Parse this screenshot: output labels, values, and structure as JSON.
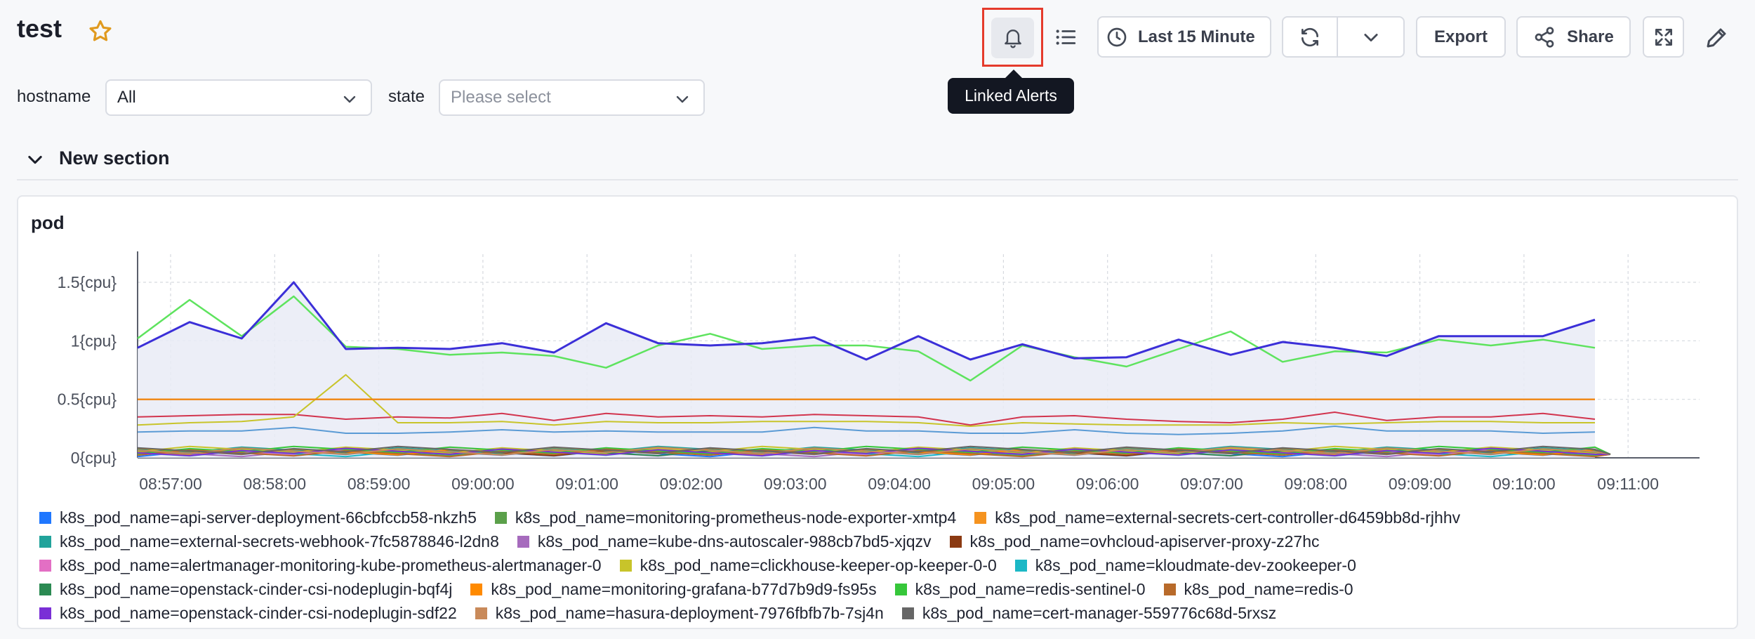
{
  "dashboard": {
    "title": "test"
  },
  "toolbar": {
    "tooltip": "Linked Alerts",
    "time_range": "Last 15 Minute",
    "export_label": "Export",
    "share_label": "Share"
  },
  "filters": [
    {
      "label": "hostname",
      "value": "All",
      "placeholder": ""
    },
    {
      "label": "state",
      "value": "",
      "placeholder": "Please select"
    }
  ],
  "section": {
    "title": "New section"
  },
  "panel": {
    "title": "pod"
  },
  "chart_data": {
    "type": "line",
    "area_fill": true,
    "x": [
      "08:57:00",
      "08:58:00",
      "08:59:00",
      "09:00:00",
      "09:01:00",
      "09:02:00",
      "09:03:00",
      "09:04:00",
      "09:05:00",
      "09:06:00",
      "09:07:00",
      "09:08:00",
      "09:09:00",
      "09:10:00",
      "09:11:00"
    ],
    "y_ticks": [
      "0{cpu}",
      "0.5{cpu}",
      "1{cpu}",
      "1.5{cpu}"
    ],
    "ylim": [
      0,
      1.7
    ],
    "grid": true,
    "legend_position": "bottom",
    "series": [
      {
        "name": "k8s_pod_name=api-server-deployment-66cbfccb58-nkzh5",
        "color": "#1f77ff",
        "legend_row": 0
      },
      {
        "name": "k8s_pod_name=monitoring-prometheus-node-exporter-xmtp4",
        "color": "#5ba04a",
        "legend_row": 0
      },
      {
        "name": "k8s_pod_name=external-secrets-cert-controller-d6459bb8d-rjhhv",
        "color": "#f5931f",
        "legend_row": 0
      },
      {
        "name": "k8s_pod_name=external-secrets-webhook-7fc5878846-l2dn8",
        "color": "#21a39b",
        "legend_row": 1
      },
      {
        "name": "k8s_pod_name=kube-dns-autoscaler-988cb7bd5-xjqzv",
        "color": "#a66bbd",
        "legend_row": 1
      },
      {
        "name": "k8s_pod_name=ovhcloud-apiserver-proxy-z27hc",
        "color": "#8b3a12",
        "legend_row": 1
      },
      {
        "name": "k8s_pod_name=alertmanager-monitoring-kube-prometheus-alertmanager-0",
        "color": "#e36fc4",
        "legend_row": 2
      },
      {
        "name": "k8s_pod_name=clickhouse-keeper-op-keeper-0-0",
        "color": "#c8c42a",
        "legend_row": 2
      },
      {
        "name": "k8s_pod_name=kloudmate-dev-zookeeper-0",
        "color": "#1cb8c6",
        "legend_row": 2
      },
      {
        "name": "k8s_pod_name=openstack-cinder-csi-nodeplugin-bqf4j",
        "color": "#2b8a52",
        "legend_row": 3
      },
      {
        "name": "k8s_pod_name=monitoring-grafana-b77d7b9d9-fs95s",
        "color": "#ff8a00",
        "legend_row": 3
      },
      {
        "name": "k8s_pod_name=redis-sentinel-0",
        "color": "#36c73a",
        "legend_row": 3
      },
      {
        "name": "k8s_pod_name=redis-0",
        "color": "#b86a2a",
        "legend_row": 3
      },
      {
        "name": "k8s_pod_name=openstack-cinder-csi-nodeplugin-sdf22",
        "color": "#7a2fd6",
        "legend_row": 4
      },
      {
        "name": "k8s_pod_name=hasura-deployment-7976fbfb7b-7sj4n",
        "color": "#c98a5a",
        "legend_row": 4
      },
      {
        "name": "k8s_pod_name=cert-manager-559776c68d-5rxsz",
        "color": "#666666",
        "legend_row": 4
      }
    ],
    "plotted_lines": [
      {
        "color": "#3b2fd8",
        "width": 3,
        "fill": true,
        "values": [
          0.94,
          1.16,
          1.02,
          1.5,
          0.93,
          0.94,
          0.93,
          0.98,
          0.9,
          1.15,
          0.98,
          0.96,
          0.98,
          1.03,
          0.84,
          1.04,
          0.84,
          0.97,
          0.85,
          0.86,
          1.01,
          0.88,
          0.99,
          0.94,
          0.87,
          1.04,
          1.04,
          1.04,
          1.18
        ]
      },
      {
        "color": "#5ee35e",
        "width": 2.5,
        "fill": false,
        "values": [
          1.02,
          1.35,
          1.04,
          1.38,
          0.95,
          0.93,
          0.88,
          0.9,
          0.87,
          0.77,
          0.96,
          1.06,
          0.93,
          0.96,
          0.96,
          0.91,
          0.66,
          0.96,
          0.86,
          0.78,
          0.93,
          1.08,
          0.82,
          0.91,
          0.9,
          1.01,
          0.96,
          1.01,
          0.94
        ]
      },
      {
        "color": "#f08a1c",
        "width": 2.5,
        "fill": false,
        "values": [
          0.5,
          0.5,
          0.5,
          0.5,
          0.5,
          0.5,
          0.5,
          0.5,
          0.5,
          0.5,
          0.5,
          0.5,
          0.5,
          0.5,
          0.5,
          0.5,
          0.5,
          0.5,
          0.5,
          0.5,
          0.5,
          0.5,
          0.5,
          0.5,
          0.5,
          0.5,
          0.5,
          0.5,
          0.5
        ]
      },
      {
        "color": "#c8c42a",
        "width": 2,
        "fill": false,
        "values": [
          0.28,
          0.3,
          0.31,
          0.35,
          0.71,
          0.3,
          0.3,
          0.31,
          0.28,
          0.31,
          0.3,
          0.3,
          0.31,
          0.31,
          0.31,
          0.3,
          0.27,
          0.3,
          0.29,
          0.28,
          0.28,
          0.28,
          0.3,
          0.29,
          0.3,
          0.31,
          0.31,
          0.3,
          0.3
        ]
      },
      {
        "color": "#d2344e",
        "width": 2,
        "fill": false,
        "values": [
          0.35,
          0.36,
          0.37,
          0.37,
          0.33,
          0.35,
          0.34,
          0.38,
          0.32,
          0.38,
          0.35,
          0.36,
          0.35,
          0.37,
          0.36,
          0.35,
          0.28,
          0.35,
          0.36,
          0.33,
          0.31,
          0.3,
          0.33,
          0.39,
          0.32,
          0.35,
          0.35,
          0.38,
          0.33
        ]
      },
      {
        "color": "#5b9bd5",
        "width": 2,
        "fill": false,
        "values": [
          0.22,
          0.23,
          0.23,
          0.26,
          0.21,
          0.21,
          0.22,
          0.24,
          0.22,
          0.23,
          0.22,
          0.22,
          0.22,
          0.26,
          0.23,
          0.23,
          0.21,
          0.21,
          0.24,
          0.21,
          0.2,
          0.21,
          0.23,
          0.27,
          0.23,
          0.23,
          0.23,
          0.21,
          0.22
        ]
      }
    ]
  }
}
